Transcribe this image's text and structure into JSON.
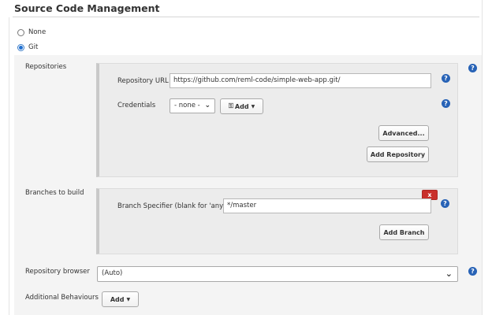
{
  "section": {
    "title": "Source Code Management"
  },
  "scm": {
    "options": [
      {
        "label": "None",
        "checked": false
      },
      {
        "label": "Git",
        "checked": true
      }
    ]
  },
  "repositories": {
    "label": "Repositories",
    "url_label": "Repository URL",
    "url_value": "https://github.com/reml-code/simple-web-app.git/",
    "credentials_label": "Credentials",
    "credentials_value": "- none -",
    "add_label": "Add",
    "advanced_label": "Advanced...",
    "add_repository_label": "Add Repository"
  },
  "branches": {
    "label": "Branches to build",
    "delete_label": "x",
    "specifier_label": "Branch Specifier (blank for 'any')",
    "specifier_value": "*/master",
    "add_branch_label": "Add Branch"
  },
  "browser": {
    "label": "Repository browser",
    "value": "(Auto)"
  },
  "behaviours": {
    "label": "Additional Behaviours",
    "add_label": "Add"
  },
  "help": {
    "glyph": "?"
  },
  "icons": {
    "help": "help-icon",
    "credentials_add": "key-icon",
    "dropdown": "chevron-down-icon",
    "caret": "caret-down-icon"
  },
  "colors": {
    "help": "#2762b6",
    "delete": "#c9302c",
    "radio_checked": "#1f6fd1"
  }
}
